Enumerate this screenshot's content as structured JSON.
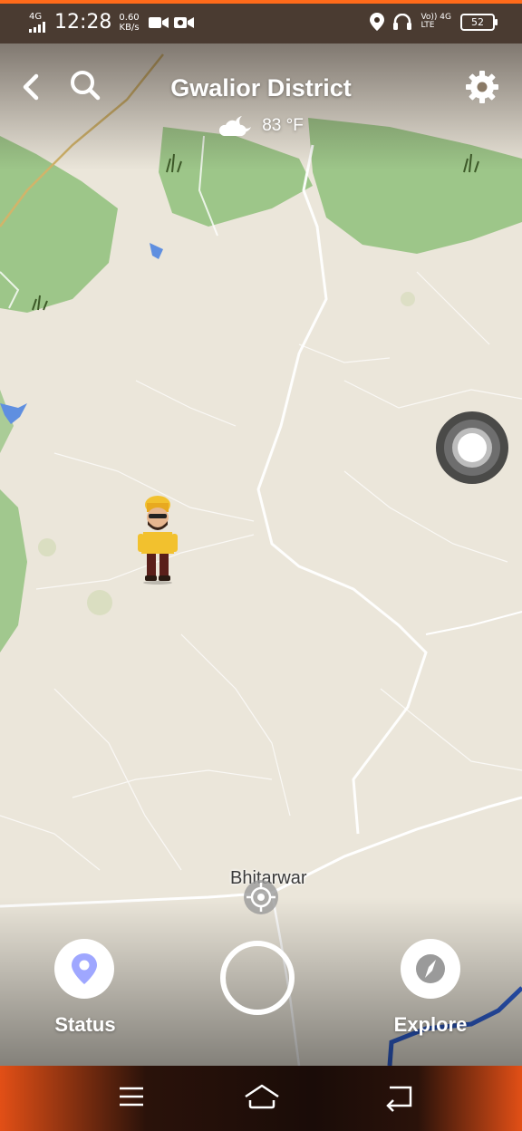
{
  "status_bar": {
    "network": "4G",
    "time": "12:28",
    "speed_value": "0.60",
    "speed_unit": "KB/s",
    "lte_line1": "Vo)) 4G",
    "lte_line2": "LTE",
    "battery": "52"
  },
  "header": {
    "title": "Gwalior District",
    "weather_icon": "cloudy-night-icon",
    "temperature": "83 °F"
  },
  "map": {
    "place_name": "Bhitarwar"
  },
  "bottom_bar": {
    "status_label": "Status",
    "explore_label": "Explore"
  },
  "colors": {
    "accent": "#ff6a1a",
    "map_land": "#ebe6da",
    "forest": "#8fc07a",
    "water": "#2f5fd0"
  }
}
